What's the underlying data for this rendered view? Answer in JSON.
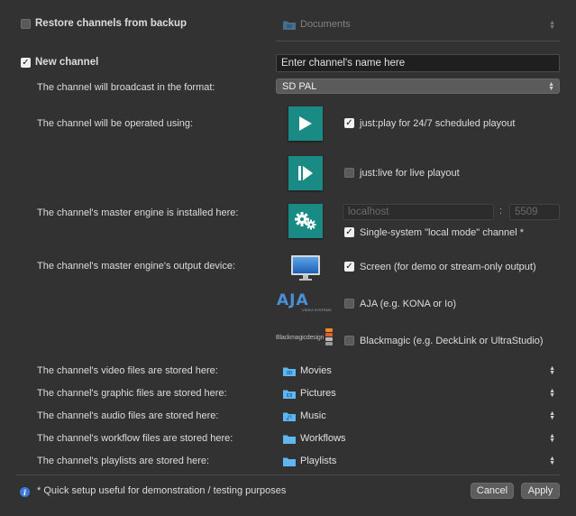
{
  "restore": {
    "checkbox_checked": false,
    "label": "Restore channels from backup",
    "folder_label": "Documents"
  },
  "new_channel": {
    "checkbox_checked": true,
    "label": "New channel",
    "name_placeholder": "Enter channel's name here",
    "format_label": "The channel will broadcast in the format:",
    "format_value": "SD PAL",
    "operated_label": "The channel will be operated using:",
    "justplay_checked": true,
    "justplay_label": "just:play for 24/7 scheduled playout",
    "justlive_checked": false,
    "justlive_label": "just:live for live playout",
    "engine_label": "The channel's master engine is installed here:",
    "host_placeholder": "localhost",
    "port_separator": ":",
    "port_placeholder": "5509",
    "local_mode_checked": true,
    "local_mode_label": "Single-system \"local mode\" channel *",
    "output_label": "The channel's master engine's output device:",
    "screen_checked": true,
    "screen_label": "Screen (for demo or stream-only output)",
    "aja_checked": false,
    "aja_label": "AJA (e.g. KONA or Io)",
    "aja_logo": "AJA",
    "aja_logo_sub": "VIDEO SYSTEMS",
    "bm_checked": false,
    "bm_label": "Blackmagic (e.g. DeckLink or UltraStudio)",
    "bm_logo": "Blackmagicdesign"
  },
  "storage": [
    {
      "label": "The channel's video files are stored here:",
      "folder": "Movies",
      "icon": "movies-folder-icon"
    },
    {
      "label": "The channel's graphic files are stored here:",
      "folder": "Pictures",
      "icon": "pictures-folder-icon"
    },
    {
      "label": "The channel's audio files are stored here:",
      "folder": "Music",
      "icon": "music-folder-icon"
    },
    {
      "label": "The channel's workflow files are stored here:",
      "folder": "Workflows",
      "icon": "folder-icon"
    },
    {
      "label": "The channel's playlists are stored here:",
      "folder": "Playlists",
      "icon": "folder-icon"
    }
  ],
  "footer": {
    "note": "* Quick setup useful for demonstration / testing purposes",
    "cancel_label": "Cancel",
    "apply_label": "Apply"
  },
  "colors": {
    "background": "#323232",
    "tile": "#1a8a84",
    "folder": "#5fb7f2",
    "info": "#3d7bd6"
  }
}
